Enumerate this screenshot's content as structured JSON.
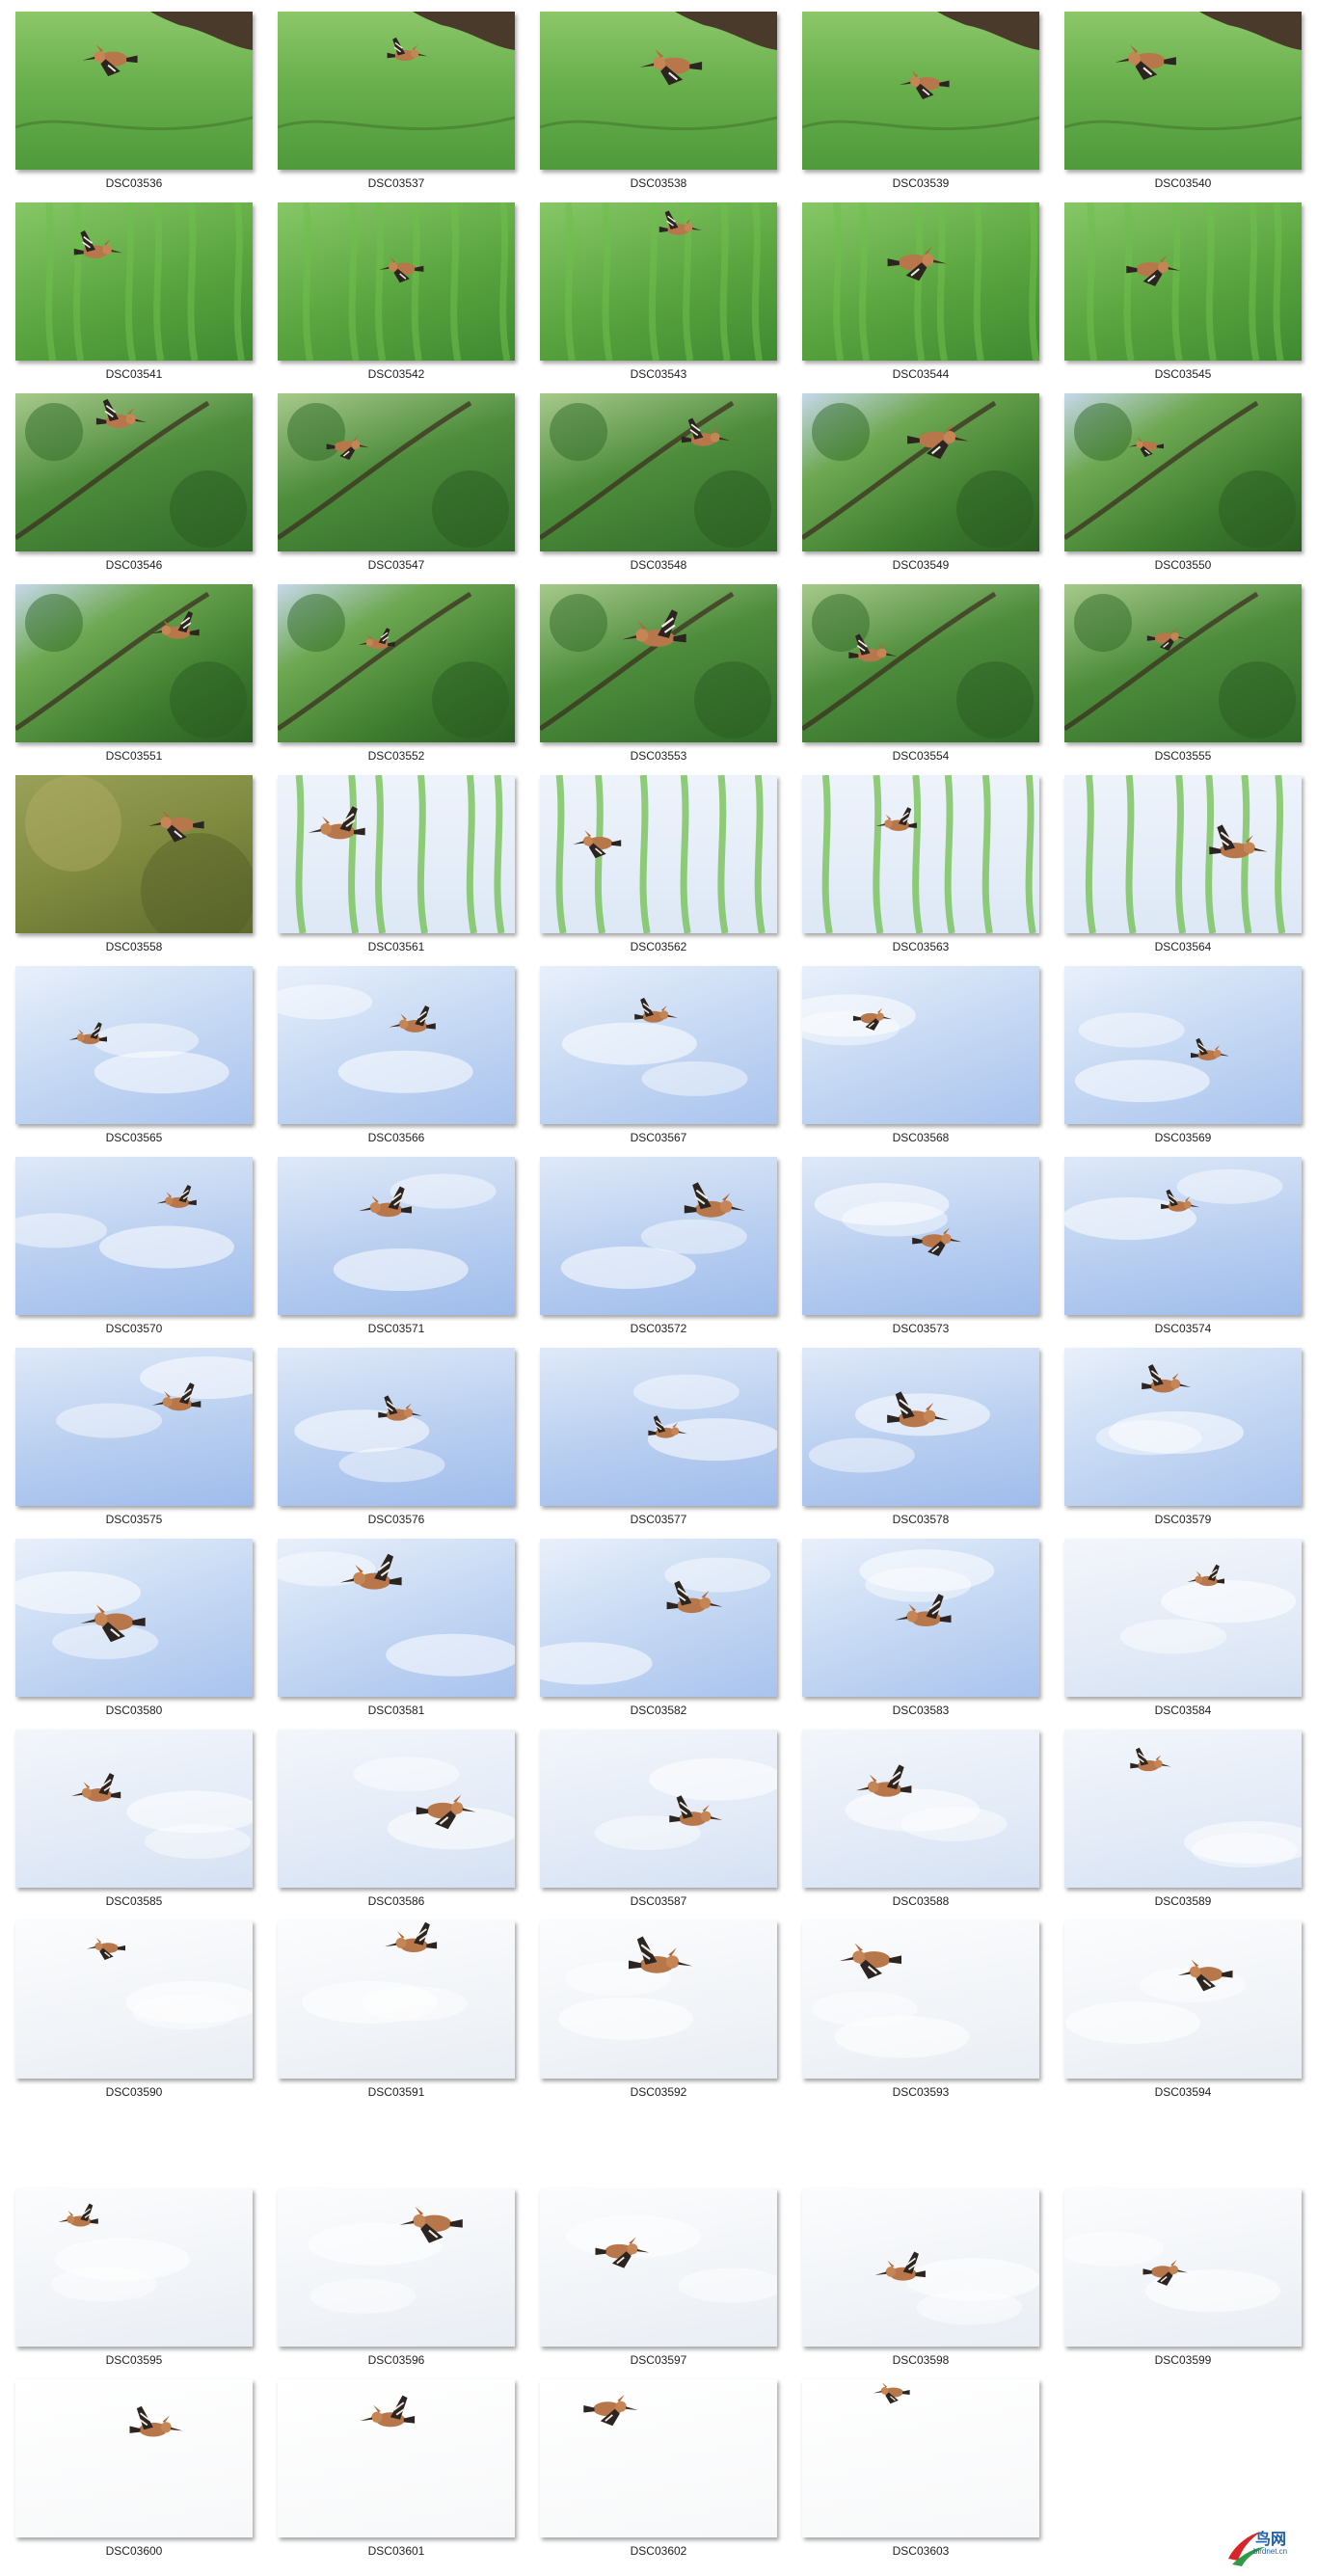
{
  "gallery": {
    "items": [
      {
        "name": "DSC03536",
        "scene": "forest-branch"
      },
      {
        "name": "DSC03537",
        "scene": "forest-branch"
      },
      {
        "name": "DSC03538",
        "scene": "forest-branch"
      },
      {
        "name": "DSC03539",
        "scene": "forest-branch"
      },
      {
        "name": "DSC03540",
        "scene": "forest-branch"
      },
      {
        "name": "DSC03541",
        "scene": "willow"
      },
      {
        "name": "DSC03542",
        "scene": "willow"
      },
      {
        "name": "DSC03543",
        "scene": "willow"
      },
      {
        "name": "DSC03544",
        "scene": "willow"
      },
      {
        "name": "DSC03545",
        "scene": "willow"
      },
      {
        "name": "DSC03546",
        "scene": "pine"
      },
      {
        "name": "DSC03547",
        "scene": "pine"
      },
      {
        "name": "DSC03548",
        "scene": "pine"
      },
      {
        "name": "DSC03549",
        "scene": "tree"
      },
      {
        "name": "DSC03550",
        "scene": "tree"
      },
      {
        "name": "DSC03551",
        "scene": "tree"
      },
      {
        "name": "DSC03552",
        "scene": "tree"
      },
      {
        "name": "DSC03553",
        "scene": "pine"
      },
      {
        "name": "DSC03554",
        "scene": "pine"
      },
      {
        "name": "DSC03555",
        "scene": "pine"
      },
      {
        "name": "DSC03558",
        "scene": "olive"
      },
      {
        "name": "DSC03561",
        "scene": "sky-willow"
      },
      {
        "name": "DSC03562",
        "scene": "sky-willow"
      },
      {
        "name": "DSC03563",
        "scene": "sky-willow"
      },
      {
        "name": "DSC03564",
        "scene": "sky-willow"
      },
      {
        "name": "DSC03565",
        "scene": "blue"
      },
      {
        "name": "DSC03566",
        "scene": "blue"
      },
      {
        "name": "DSC03567",
        "scene": "blue"
      },
      {
        "name": "DSC03568",
        "scene": "blue"
      },
      {
        "name": "DSC03569",
        "scene": "blue"
      },
      {
        "name": "DSC03570",
        "scene": "blue2"
      },
      {
        "name": "DSC03571",
        "scene": "blue2"
      },
      {
        "name": "DSC03572",
        "scene": "blue2"
      },
      {
        "name": "DSC03573",
        "scene": "blue2"
      },
      {
        "name": "DSC03574",
        "scene": "blue2"
      },
      {
        "name": "DSC03575",
        "scene": "blue2"
      },
      {
        "name": "DSC03576",
        "scene": "blue2"
      },
      {
        "name": "DSC03577",
        "scene": "blue2"
      },
      {
        "name": "DSC03578",
        "scene": "blue2"
      },
      {
        "name": "DSC03579",
        "scene": "blue"
      },
      {
        "name": "DSC03580",
        "scene": "blue"
      },
      {
        "name": "DSC03581",
        "scene": "blue"
      },
      {
        "name": "DSC03582",
        "scene": "blue"
      },
      {
        "name": "DSC03583",
        "scene": "blue"
      },
      {
        "name": "DSC03584",
        "scene": "pale"
      },
      {
        "name": "DSC03585",
        "scene": "pale"
      },
      {
        "name": "DSC03586",
        "scene": "pale"
      },
      {
        "name": "DSC03587",
        "scene": "pale"
      },
      {
        "name": "DSC03588",
        "scene": "pale"
      },
      {
        "name": "DSC03589",
        "scene": "pale"
      },
      {
        "name": "DSC03590",
        "scene": "white"
      },
      {
        "name": "DSC03591",
        "scene": "white"
      },
      {
        "name": "DSC03592",
        "scene": "white"
      },
      {
        "name": "DSC03593",
        "scene": "white"
      },
      {
        "name": "DSC03594",
        "scene": "white"
      },
      {
        "name": "DSC03595",
        "scene": "white"
      },
      {
        "name": "DSC03596",
        "scene": "white"
      },
      {
        "name": "DSC03597",
        "scene": "white"
      },
      {
        "name": "DSC03598",
        "scene": "white"
      },
      {
        "name": "DSC03599",
        "scene": "white"
      },
      {
        "name": "DSC03600",
        "scene": "whitest"
      },
      {
        "name": "DSC03601",
        "scene": "whitest"
      },
      {
        "name": "DSC03602",
        "scene": "whitest"
      },
      {
        "name": "DSC03603",
        "scene": "whitest"
      }
    ]
  },
  "watermark": {
    "title": "鸟网",
    "subtitle": "birdnet.cn",
    "colors": {
      "red": "#d9252a",
      "green": "#2e9a46",
      "blue": "#1d5fa8"
    }
  }
}
